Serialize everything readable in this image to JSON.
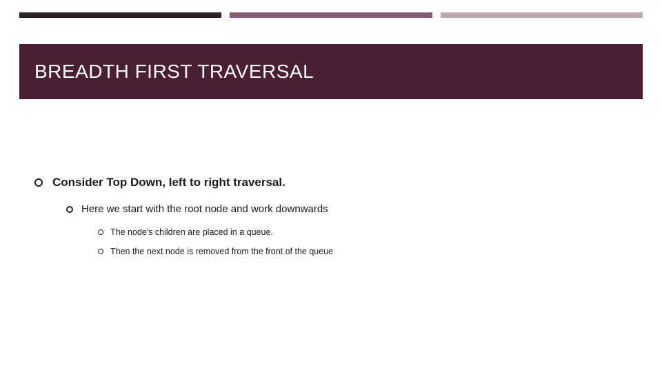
{
  "title": "BREADTH FIRST TRAVERSAL",
  "bullets": {
    "l1": "Consider Top Down, left to right traversal.",
    "l2": "Here we start with the root node and work downwards",
    "l3a": "The node's children are placed in a queue.",
    "l3b": "Then the next node is removed from the front of the queue"
  },
  "colors": {
    "seg1": "#2c2224",
    "seg2": "#8a5a73",
    "seg3": "#bfa8b5",
    "band": "#4a1f33"
  }
}
